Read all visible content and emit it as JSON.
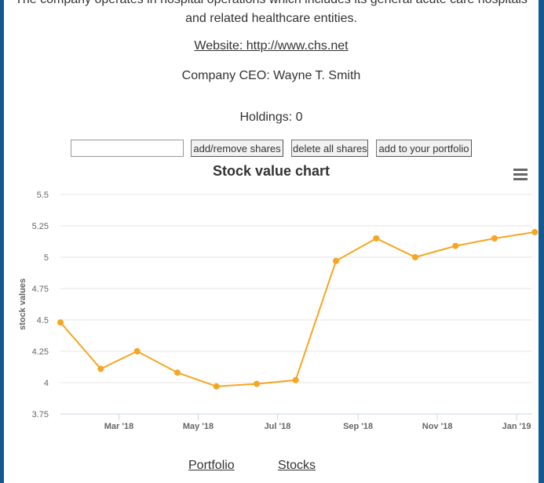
{
  "company": {
    "description_line1": "The company operates in hospital operations which includes its general acute care hospitals",
    "description_line2": "and related healthcare entities.",
    "website": "Website: http://www.chs.net",
    "ceo": "Company CEO: Wayne T. Smith",
    "holdings": "Holdings: 0"
  },
  "controls": {
    "shares_input_value": "",
    "add_remove_label": "add/remove shares",
    "delete_all_label": "delete all shares",
    "add_portfolio_label": "add to your portfolio"
  },
  "chart_menu_icon": "hamburger-menu-icon",
  "chart_data": {
    "type": "line",
    "title": "Stock value chart",
    "ylabel": "stock values",
    "xlabel": "",
    "ylim": [
      3.75,
      5.5
    ],
    "y_ticks": [
      "3.75",
      "4",
      "4.25",
      "4.5",
      "4.75",
      "5",
      "5.25",
      "5.5"
    ],
    "x_ticks": [
      "Mar '18",
      "May '18",
      "Jul '18",
      "Sep '18",
      "Nov '18",
      "Jan '19"
    ],
    "x": [
      "2018-01-15",
      "2018-02-15",
      "2018-03-15",
      "2018-04-15",
      "2018-05-15",
      "2018-06-15",
      "2018-07-15",
      "2018-08-15",
      "2018-09-15",
      "2018-10-15",
      "2018-11-15",
      "2018-12-15",
      "2019-01-15"
    ],
    "values": [
      4.48,
      4.11,
      4.25,
      4.08,
      3.97,
      3.99,
      4.02,
      4.97,
      5.15,
      5.0,
      5.09,
      5.15,
      5.2
    ],
    "grid": true,
    "series_color": "#f5a623"
  },
  "nav": {
    "portfolio": "Portfolio",
    "stocks": "Stocks"
  }
}
